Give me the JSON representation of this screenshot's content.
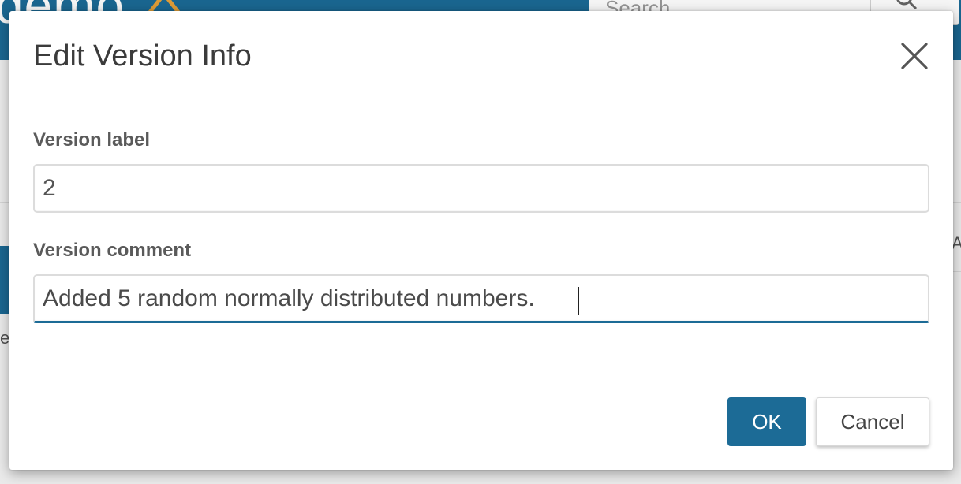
{
  "background": {
    "logo_text": "demo",
    "search_placeholder": "Search",
    "left_fragment": "e",
    "right_fragment": "A"
  },
  "dialog": {
    "title": "Edit Version Info",
    "close_icon": "close-icon",
    "fields": {
      "version_label": {
        "label": "Version label",
        "value": "2"
      },
      "version_comment": {
        "label": "Version comment",
        "value": "Added 5 random normally distributed numbers."
      }
    },
    "buttons": {
      "ok": "OK",
      "cancel": "Cancel"
    }
  },
  "colors": {
    "primary": "#1c6b96",
    "logo_accent": "#e8a33a",
    "title_text": "#3b3b3b",
    "label_text": "#5a5a5a"
  }
}
